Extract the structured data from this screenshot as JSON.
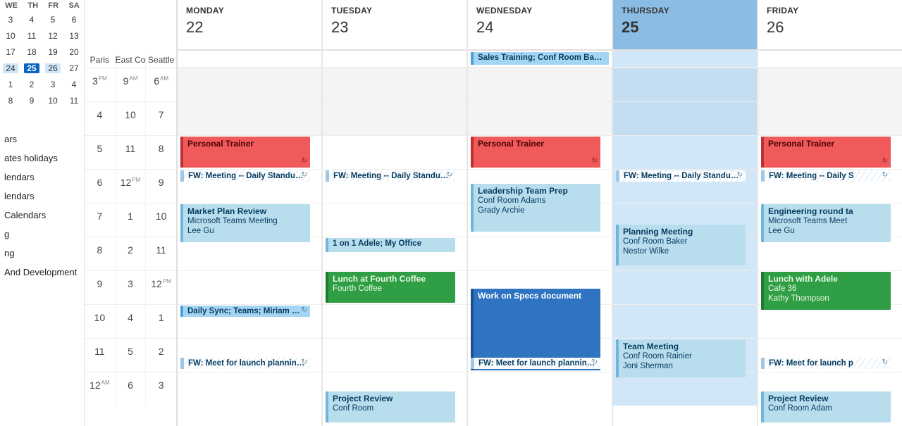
{
  "mini_calendar": {
    "day_headers": [
      "WE",
      "TH",
      "FR",
      "SA"
    ],
    "rows": [
      [
        {
          "n": "3"
        },
        {
          "n": "4"
        },
        {
          "n": "5"
        },
        {
          "n": "6"
        }
      ],
      [
        {
          "n": "10"
        },
        {
          "n": "11"
        },
        {
          "n": "12"
        },
        {
          "n": "13"
        }
      ],
      [
        {
          "n": "17"
        },
        {
          "n": "18"
        },
        {
          "n": "19"
        },
        {
          "n": "20"
        }
      ],
      [
        {
          "n": "24",
          "hl": true
        },
        {
          "n": "25",
          "today": true
        },
        {
          "n": "26",
          "hl": true
        },
        {
          "n": "27"
        }
      ],
      [
        {
          "n": "1"
        },
        {
          "n": "2"
        },
        {
          "n": "3"
        },
        {
          "n": "4"
        }
      ],
      [
        {
          "n": "8"
        },
        {
          "n": "9"
        },
        {
          "n": "10"
        },
        {
          "n": "11"
        }
      ]
    ]
  },
  "calendar_lists": [
    {
      "label": "ars"
    },
    {
      "label": "ates holidays"
    },
    {
      "label": "lendars"
    },
    {
      "label": "lendars"
    },
    {
      "label": "Calendars"
    },
    {
      "label": "g"
    },
    {
      "label": "ng"
    },
    {
      "label": "And Development"
    }
  ],
  "timezones": {
    "labels": [
      "Paris",
      "East Co",
      "Seattle"
    ],
    "rows": [
      [
        {
          "h": "3",
          "m": "PM"
        },
        {
          "h": "9",
          "m": "AM"
        },
        {
          "h": "6",
          "m": "AM"
        }
      ],
      [
        {
          "h": "4"
        },
        {
          "h": "10"
        },
        {
          "h": "7"
        }
      ],
      [
        {
          "h": "5"
        },
        {
          "h": "11"
        },
        {
          "h": "8"
        }
      ],
      [
        {
          "h": "6"
        },
        {
          "h": "12",
          "m": "PM"
        },
        {
          "h": "9"
        }
      ],
      [
        {
          "h": "7"
        },
        {
          "h": "1"
        },
        {
          "h": "10"
        }
      ],
      [
        {
          "h": "8"
        },
        {
          "h": "2"
        },
        {
          "h": "11"
        }
      ],
      [
        {
          "h": "9"
        },
        {
          "h": "3"
        },
        {
          "h": "12",
          "m": "PM"
        }
      ],
      [
        {
          "h": "10"
        },
        {
          "h": "4"
        },
        {
          "h": "1"
        }
      ],
      [
        {
          "h": "11"
        },
        {
          "h": "5"
        },
        {
          "h": "2"
        }
      ],
      [
        {
          "h": "12",
          "m": "AM"
        },
        {
          "h": "6"
        },
        {
          "h": "3"
        }
      ]
    ]
  },
  "days": [
    {
      "name": "MONDAY",
      "num": "22",
      "today": false,
      "allday": [],
      "events": [
        {
          "title": "Personal Trainer",
          "sub": "",
          "color": "ev-red",
          "start": 2,
          "dur": 1,
          "recur": true
        },
        {
          "title": "FW: Meeting -- Daily Standup; Co",
          "sub": "",
          "color": "ev-hblue hatch",
          "start": 3,
          "dur": 0.4,
          "thin": true,
          "recur": true
        },
        {
          "title": "Market Plan Review",
          "sub": "Microsoft Teams Meeting\nLee Gu",
          "color": "ev-lightbl",
          "start": 4,
          "dur": 1.2
        },
        {
          "title": "Daily Sync; Teams; Miriam Graham",
          "sub": "",
          "color": "ev-blue",
          "start": 7,
          "dur": 0.4,
          "thin": true,
          "recur": true
        },
        {
          "title": "FW: Meet for launch planning ; M",
          "sub": "",
          "color": "ev-hblue hatch",
          "start": 8.55,
          "dur": 0.4,
          "thin": true,
          "recur": true
        }
      ]
    },
    {
      "name": "TUESDAY",
      "num": "23",
      "today": false,
      "allday": [],
      "events": [
        {
          "title": "FW: Meeting -- Daily Standup; Co",
          "sub": "",
          "color": "ev-hblue hatch",
          "start": 3,
          "dur": 0.4,
          "thin": true,
          "recur": true
        },
        {
          "title": "1 on 1 Adele; My Office",
          "sub": "",
          "color": "ev-lightbl",
          "start": 5,
          "dur": 0.5,
          "thin": true
        },
        {
          "title": "Lunch at Fourth Coffee",
          "sub": "Fourth Coffee",
          "color": "ev-green",
          "start": 6,
          "dur": 1
        },
        {
          "title": "Project Review",
          "sub": "Conf Room",
          "color": "ev-lightbl",
          "start": 9.55,
          "dur": 1
        }
      ]
    },
    {
      "name": "WEDNESDAY",
      "num": "24",
      "today": false,
      "allday": [
        {
          "title": "Sales Training; Conf Room Baker; K...",
          "color": "ev-blue"
        }
      ],
      "events": [
        {
          "title": "Personal Trainer",
          "sub": "",
          "color": "ev-red",
          "start": 2,
          "dur": 1,
          "recur": true
        },
        {
          "title": "Leadership Team Prep",
          "sub": "Conf Room Adams\nGrady Archie",
          "color": "ev-lightbl",
          "start": 3.4,
          "dur": 1.5
        },
        {
          "title": "Work on Specs document",
          "sub": "",
          "color": "ev-darkblue",
          "start": 6.5,
          "dur": 2.5
        },
        {
          "title": "FW: Meet for launch planning ; M",
          "sub": "",
          "color": "ev-hblue hatch",
          "start": 8.55,
          "dur": 0.4,
          "thin": true,
          "recur": true
        }
      ]
    },
    {
      "name": "THURSDAY",
      "num": "25",
      "today": true,
      "allday": [],
      "events": [
        {
          "title": "FW: Meeting -- Daily Standup; Co",
          "sub": "",
          "color": "ev-hblue hatch",
          "start": 3,
          "dur": 0.4,
          "thin": true,
          "recur": true
        },
        {
          "title": "Planning Meeting",
          "sub": "Conf Room Baker\nNestor Wilke",
          "color": "ev-lightbl",
          "start": 4.6,
          "dur": 1.3
        },
        {
          "title": "Team Meeting",
          "sub": "Conf Room Rainier\nJoni Sherman",
          "color": "ev-lightbl",
          "start": 8,
          "dur": 1.2
        }
      ]
    },
    {
      "name": "FRIDAY",
      "num": "26",
      "today": false,
      "allday": [],
      "events": [
        {
          "title": "Personal Trainer",
          "sub": "",
          "color": "ev-red",
          "start": 2,
          "dur": 1,
          "recur": true
        },
        {
          "title": "FW: Meeting -- Daily S",
          "sub": "",
          "color": "ev-hblue hatch",
          "start": 3,
          "dur": 0.4,
          "thin": true,
          "recur": true
        },
        {
          "title": "Engineering round ta",
          "sub": "Microsoft Teams Meet\nLee Gu",
          "color": "ev-lightbl",
          "start": 4,
          "dur": 1.2
        },
        {
          "title": "Lunch with Adele",
          "sub": "Cafe 36\nKathy Thompson",
          "color": "ev-green",
          "start": 6,
          "dur": 1.2
        },
        {
          "title": "FW: Meet for launch p",
          "sub": "",
          "color": "ev-hblue hatch",
          "start": 8.55,
          "dur": 0.4,
          "thin": true,
          "recur": true
        },
        {
          "title": "Project Review",
          "sub": "Conf Room Adam",
          "color": "ev-lightbl",
          "start": 9.55,
          "dur": 1
        }
      ]
    }
  ],
  "ui": {
    "recur_glyph": "↻"
  }
}
